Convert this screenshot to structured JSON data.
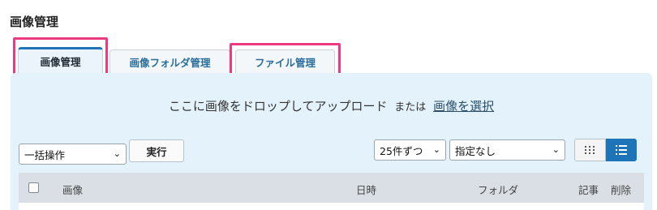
{
  "page_title": "画像管理",
  "tabs": [
    {
      "label": "画像管理",
      "active": true
    },
    {
      "label": "画像フォルダ管理",
      "active": false
    },
    {
      "label": "ファイル管理",
      "active": false
    }
  ],
  "dropzone": {
    "text": "ここに画像をドロップしてアップロード",
    "or": "または",
    "link": "画像を選択"
  },
  "bulk_action": {
    "selected": "一括操作"
  },
  "execute_label": "実行",
  "per_page": {
    "selected": "25件ずつ"
  },
  "filter": {
    "selected": "指定なし"
  },
  "table": {
    "columns": [
      "画像",
      "日時",
      "フォルダ",
      "記事",
      "削除"
    ]
  },
  "colors": {
    "accent": "#1e74b8",
    "panel": "#e3f2fb",
    "highlight": "#ec3b83"
  },
  "icons": {
    "caret": "chevron-down-icon",
    "grid": "grid-view-icon",
    "list": "list-view-icon"
  }
}
